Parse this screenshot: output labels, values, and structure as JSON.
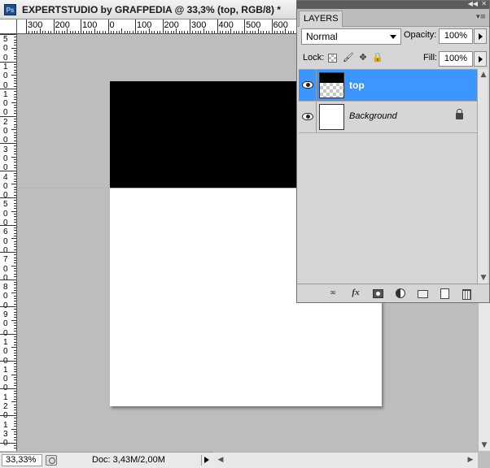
{
  "document": {
    "title": "EXPERTSTUDIO by GRAFPEDIA @ 33,3% (top, RGB/8) *",
    "app_icon": "Ps"
  },
  "rulers": {
    "horizontal_labels": [
      "300",
      "200",
      "100",
      "0",
      "100",
      "200",
      "300",
      "400",
      "500",
      "600"
    ],
    "vertical_labels": [
      "5",
      "0",
      "0",
      "1",
      "0",
      "0",
      "1",
      "0",
      "0",
      "2",
      "0",
      "0",
      "3",
      "0",
      "0",
      "4",
      "0",
      "0",
      "5",
      "0",
      "0",
      "6",
      "0",
      "0",
      "7",
      "0",
      "0",
      "8",
      "0",
      "0",
      "9",
      "0",
      "0",
      "1",
      "0",
      "0",
      "1",
      "0",
      "0",
      "1",
      "2",
      "0",
      "1",
      "3",
      "0"
    ]
  },
  "status_bar": {
    "zoom": "33,33%",
    "doc_info": "Doc: 3,43M/2,00M"
  },
  "layers_panel": {
    "tab_label": "LAYERS",
    "blend_mode": "Normal",
    "opacity_label": "Opacity:",
    "opacity_value": "100%",
    "lock_label": "Lock:",
    "fill_label": "Fill:",
    "fill_value": "100%",
    "layers": [
      {
        "name": "top",
        "selected": true,
        "visible": true
      },
      {
        "name": "Background",
        "selected": false,
        "visible": true,
        "locked": true
      }
    ],
    "lock_icons": [
      "lock-transparent-icon",
      "brush-icon",
      "move-icon",
      "lock-icon"
    ],
    "footer_icons": [
      "link-icon",
      "fx-icon",
      "mask-icon",
      "adjustment-icon",
      "folder-icon",
      "new-layer-icon",
      "trash-icon"
    ],
    "footer_fx": "fx"
  },
  "colors": {
    "selection": "#3d95ff",
    "guide": "#4fe0e8",
    "canvas_bg": "#bdbdbd"
  }
}
